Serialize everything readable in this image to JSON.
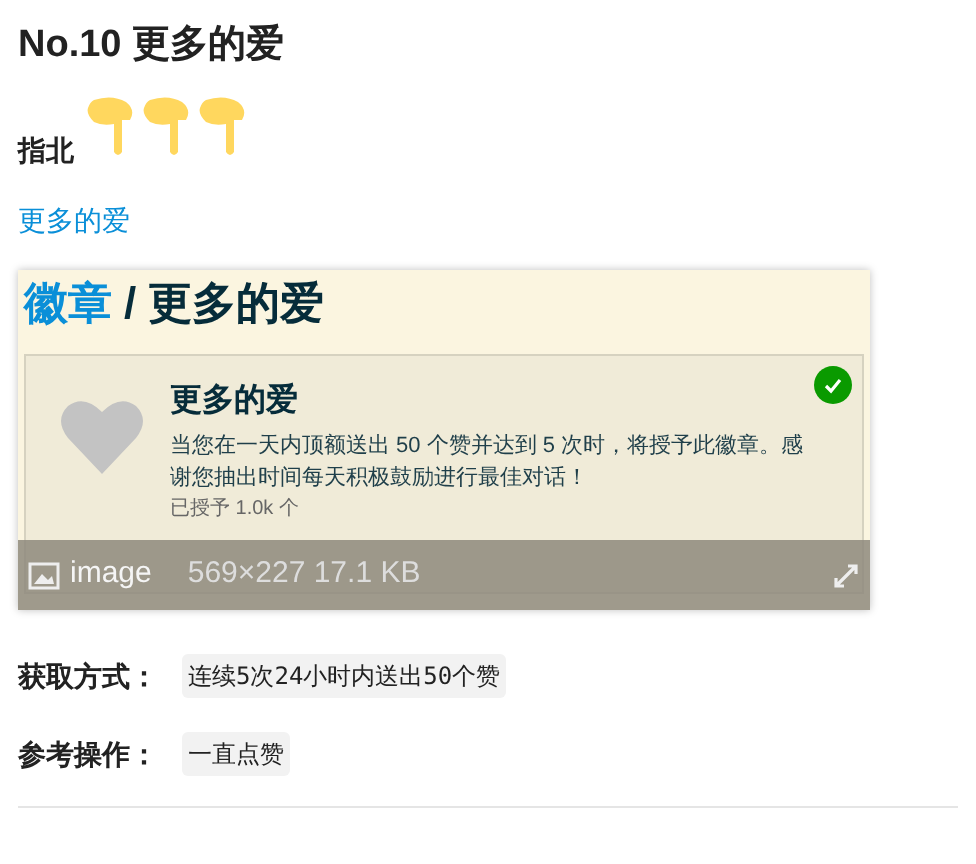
{
  "title": "No.10 更多的爱",
  "guide": {
    "label": "指北",
    "icons": [
      {
        "kind": "pointing-hand"
      },
      {
        "kind": "pointing-hand"
      },
      {
        "kind": "pointing-hand"
      }
    ]
  },
  "link": "更多的爱",
  "screenshot": {
    "breadcrumb_link": "徽章",
    "breadcrumb_sep": "/",
    "breadcrumb_current": "更多的爱",
    "badge_name": "更多的爱",
    "description": "当您在一天内顶额送出 50 个赞并达到 5 次时，将授予此徽章。感谢您抽出时间每天积极鼓励进行最佳对话！",
    "granted": "已授予 1.0k 个",
    "earned": true
  },
  "image_bar": {
    "label": "image",
    "info": "569×227 17.1 KB"
  },
  "fields": [
    {
      "label": "获取方式：",
      "value": "连续5次24小时内送出50个赞"
    },
    {
      "label": "参考操作：",
      "value": "一直点赞"
    }
  ]
}
